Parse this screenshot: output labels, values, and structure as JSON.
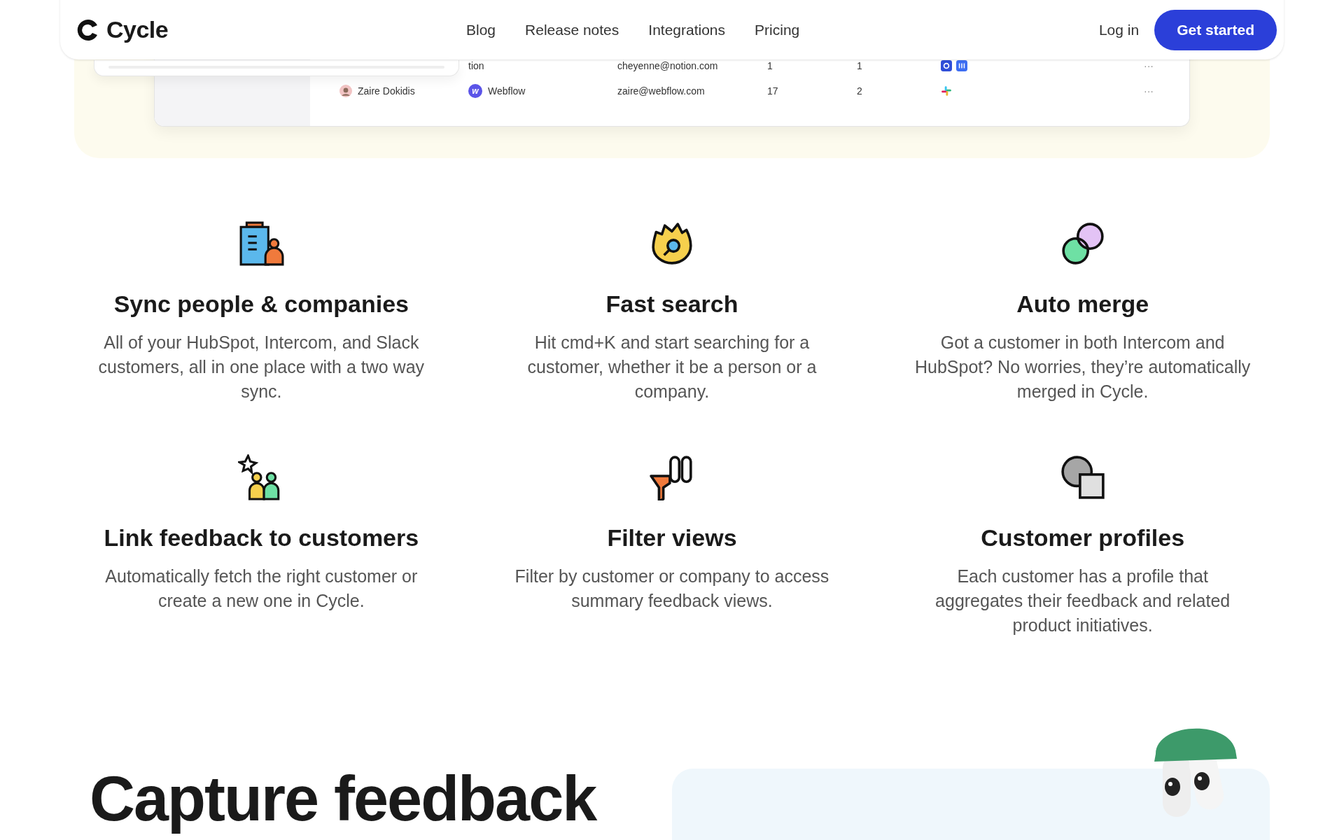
{
  "nav": {
    "logo": "Cycle",
    "links": [
      "Blog",
      "Release notes",
      "Integrations",
      "Pricing"
    ],
    "login": "Log in",
    "cta": "Get started"
  },
  "table": {
    "rows": [
      {
        "company": "tion",
        "email": "cheyenne@notion.com",
        "column_4": "1",
        "column_5": "1",
        "more": "···"
      },
      {
        "name": "Zaire Dokidis",
        "company_initial": "w",
        "company": "Webflow",
        "email": "zaire@webflow.com",
        "column_4": "17",
        "column_5": "2",
        "more": "···"
      }
    ]
  },
  "features": [
    {
      "title": "Sync people & companies",
      "text": "All of your HubSpot, Intercom, and Slack customers, all in one place with a two way sync."
    },
    {
      "title": "Fast search",
      "text": "Hit cmd+K and start searching for a customer, whether it be a person or a company."
    },
    {
      "title": "Auto merge",
      "text": "Got a customer in both Intercom and HubSpot? No worries, they’re automatically merged in Cycle."
    },
    {
      "title": "Link feedback to customers",
      "text": "Automatically fetch the right customer or create a new one in Cycle."
    },
    {
      "title": "Filter views",
      "text": "Filter by customer or company to access summary feedback views."
    },
    {
      "title": "Customer profiles",
      "text": "Each customer has a profile that aggregates their feedback and related product initiatives."
    }
  ],
  "section": {
    "heading": "Capture feedback"
  }
}
